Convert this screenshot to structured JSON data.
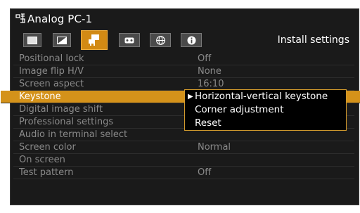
{
  "header": {
    "input_icon": "input-icon",
    "title": "Analog PC-1"
  },
  "tabs": [
    {
      "name": "tab-display",
      "icon": "rectangle-icon",
      "active": false
    },
    {
      "name": "tab-image",
      "icon": "image-adjust-icon",
      "active": false
    },
    {
      "name": "tab-install",
      "icon": "install-icon",
      "active": true
    },
    {
      "name": "tab-system",
      "icon": "system-icon",
      "active": false
    },
    {
      "name": "tab-network",
      "icon": "globe-icon",
      "active": false
    },
    {
      "name": "tab-info",
      "icon": "info-icon",
      "active": false
    }
  ],
  "section_title": "Install settings",
  "menu_items": [
    {
      "label": "Positional lock",
      "value": "Off"
    },
    {
      "label": "Image flip H/V",
      "value": "None"
    },
    {
      "label": "Screen aspect",
      "value": "16:10"
    },
    {
      "label": "Keystone",
      "value": "",
      "selected": true
    },
    {
      "label": "Digital image shift",
      "value": ""
    },
    {
      "label": "Professional settings",
      "value": ""
    },
    {
      "label": "Audio in terminal select",
      "value": ""
    },
    {
      "label": "Screen color",
      "value": "Normal"
    },
    {
      "label": "On screen",
      "value": ""
    },
    {
      "label": "Test pattern",
      "value": "Off"
    }
  ],
  "submenu": [
    {
      "label": "Horizontal-vertical keystone",
      "active": true
    },
    {
      "label": "Corner adjustment",
      "active": false
    },
    {
      "label": "Reset",
      "active": false
    }
  ],
  "colors": {
    "accent": "#d4921a",
    "background": "#1a1a1a",
    "dim_text": "#8a8a8a"
  }
}
